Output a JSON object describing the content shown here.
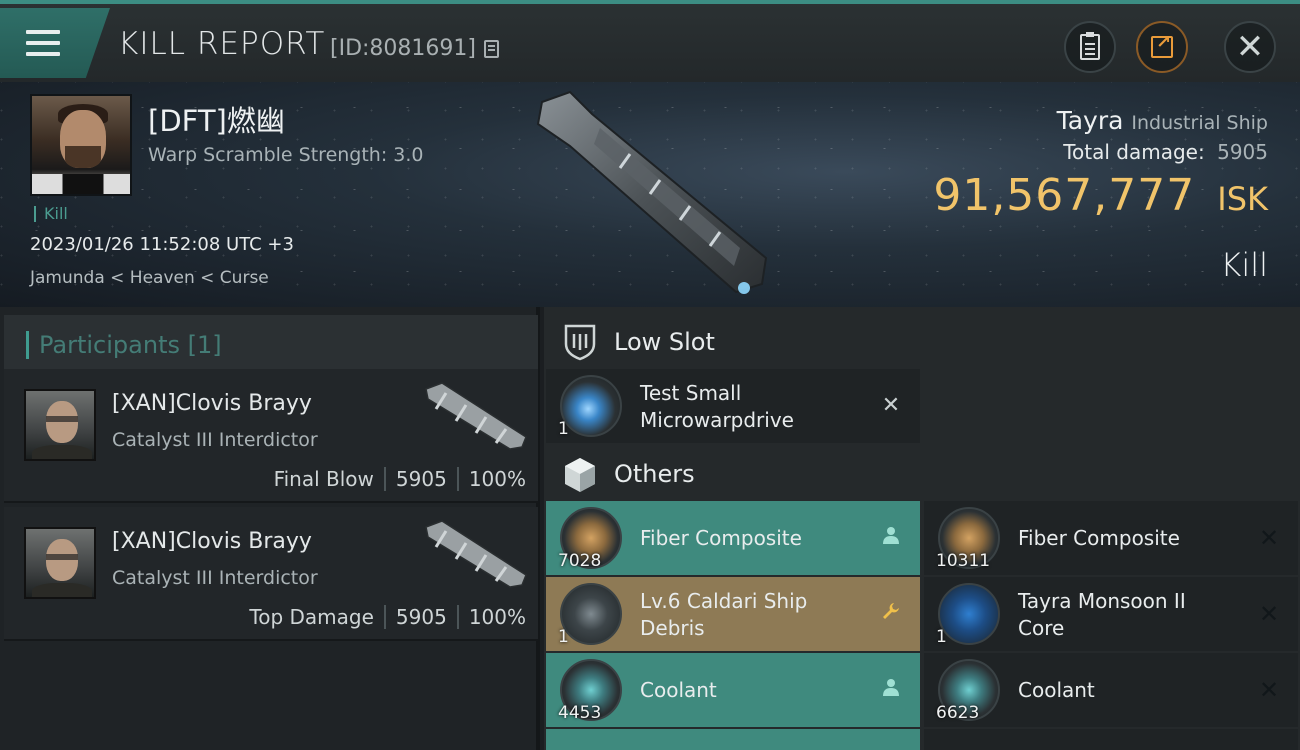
{
  "header": {
    "title": "KILL REPORT",
    "report_id": "[ID:8081691]"
  },
  "victim": {
    "name": "[DFT]燃幽",
    "warp_scramble": "Warp Scramble Strength: 3.0",
    "kill_tag": "Kill",
    "timestamp": "2023/01/26 11:52:08 UTC +3",
    "location": "Jamunda < Heaven < Curse"
  },
  "ship": {
    "name": "Tayra",
    "class": "Industrial Ship",
    "damage_label": "Total damage:",
    "damage_value": "5905",
    "isk_value": "91,567,777",
    "isk_unit": "ISK",
    "result": "Kill"
  },
  "participants": {
    "label": "Participants [1]",
    "cards": [
      {
        "name": "[XAN]Clovis Brayy",
        "ship": "Catalyst III Interdictor",
        "role": "Final Blow",
        "damage": "5905",
        "percent": "100%"
      },
      {
        "name": "[XAN]Clovis Brayy",
        "ship": "Catalyst III Interdictor",
        "role": "Top Damage",
        "damage": "5905",
        "percent": "100%"
      }
    ]
  },
  "sections": {
    "low_slot": "Low Slot",
    "others": "Others"
  },
  "items": {
    "low_slot": [
      {
        "line1": "Test Small",
        "line2": "Microwarpdrive",
        "qty": "1"
      }
    ],
    "others": [
      {
        "line1": "Fiber Composite",
        "line2": "",
        "qty": "7028"
      },
      {
        "line1": "Fiber Composite",
        "line2": "",
        "qty": "10311"
      },
      {
        "line1": "Lv.6 Caldari Ship",
        "line2": "Debris",
        "qty": "1"
      },
      {
        "line1": "Tayra Monsoon II",
        "line2": "Core",
        "qty": "1"
      },
      {
        "line1": "Coolant",
        "line2": "",
        "qty": "4453"
      },
      {
        "line1": "Coolant",
        "line2": "",
        "qty": "6623"
      }
    ]
  },
  "colors": {
    "accent": "#3f8a7e",
    "isk": "#f1c46a",
    "gold_row": "#8e7a55"
  }
}
